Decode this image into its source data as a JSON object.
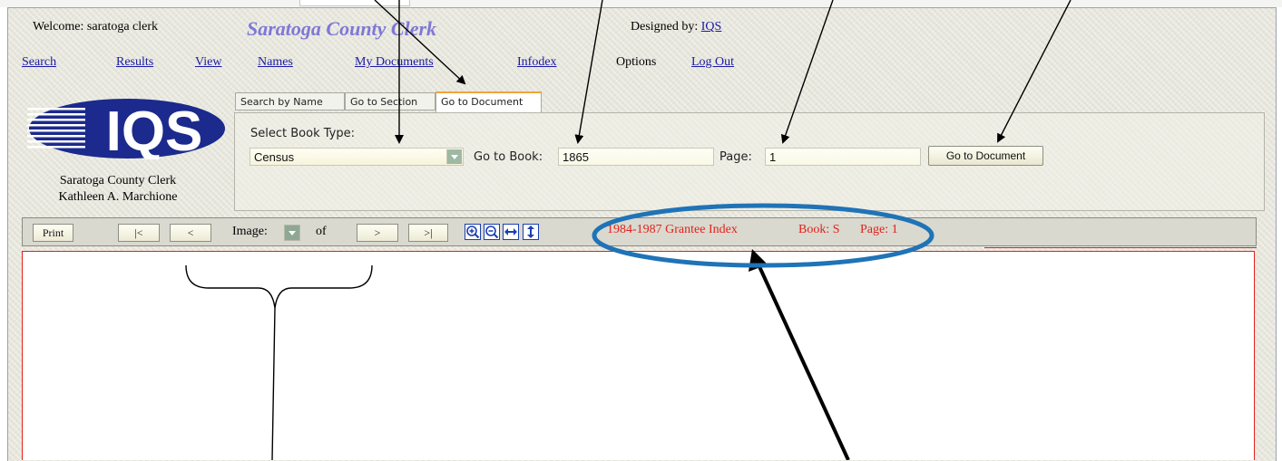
{
  "header": {
    "welcome": "Welcome: saratoga clerk",
    "title": "Saratoga County Clerk",
    "designed_by_label": "Designed by:",
    "designed_by_link": "IQS"
  },
  "nav": {
    "items": [
      "Search",
      "Results",
      "View",
      "Names",
      "My Documents",
      "Infodex",
      "Options",
      "Log Out"
    ]
  },
  "branding": {
    "logo_text": "IQS",
    "caption_line1": "Saratoga County Clerk",
    "caption_line2": "Kathleen A. Marchione"
  },
  "tabs": [
    "Search by Name",
    "Go to Section",
    "Go to Document"
  ],
  "active_tab": "Go to Document",
  "form": {
    "book_type_label": "Select Book Type:",
    "book_type_value": "Census",
    "book_label": "Go to Book:",
    "book_value": "1865",
    "page_label": "Page:",
    "page_value": "1",
    "submit_label": "Go to Document"
  },
  "toolbar": {
    "print": "Print",
    "first": "|<",
    "prev": "<",
    "image_label": "Image:",
    "of_label": "of",
    "next": ">",
    "last": ">|",
    "zoom_icons": [
      "zoom-in-icon",
      "zoom-out-icon",
      "fit-width-icon",
      "fit-height-icon"
    ]
  },
  "document_info": {
    "index_name": "1984-1987 Grantee Index",
    "book": "Book: S",
    "page": "Page: 1"
  },
  "colors": {
    "accent_title": "#7e78d6",
    "link": "#1a1aa6",
    "info_red": "#e3201b",
    "highlight_oval": "#1f73b7",
    "active_tab_top": "#f3a43a"
  }
}
